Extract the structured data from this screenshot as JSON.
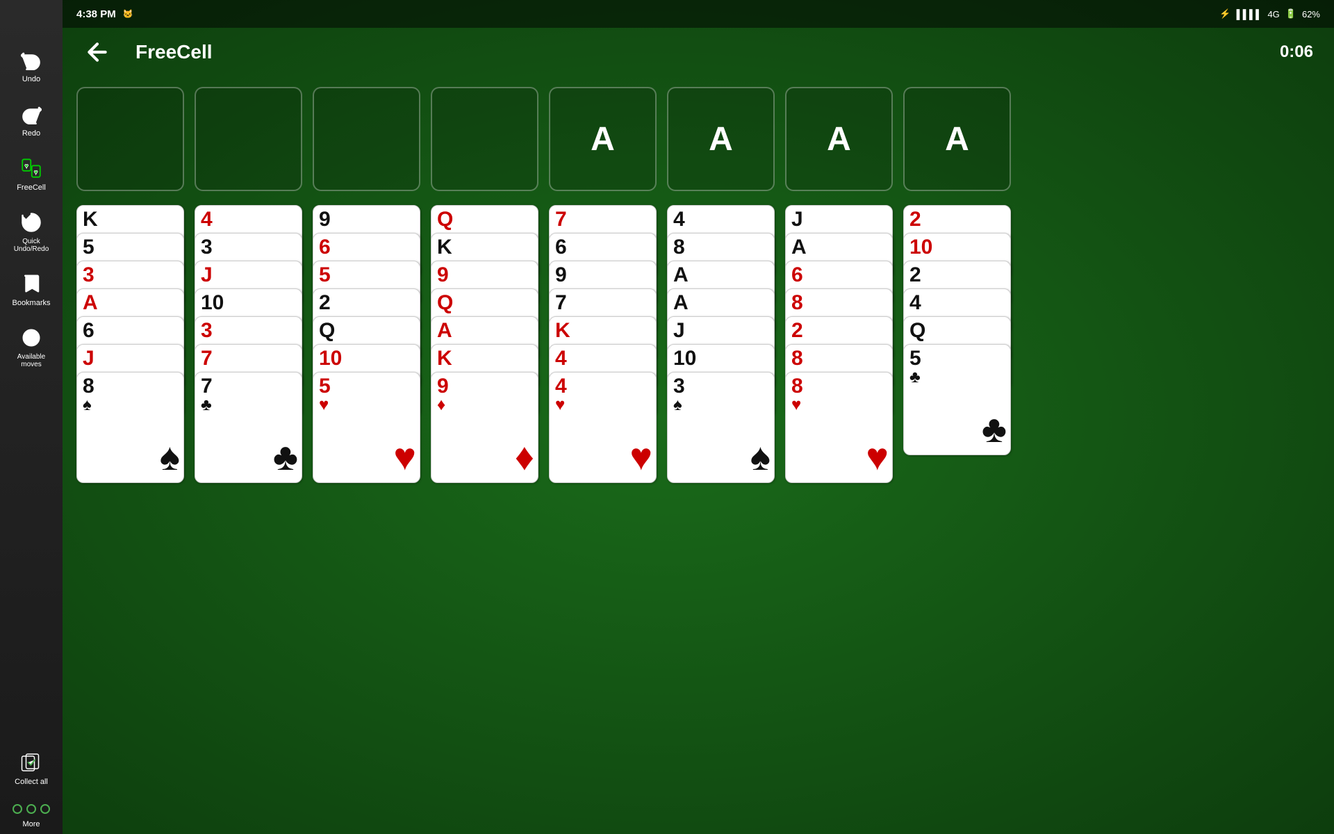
{
  "statusbar": {
    "time": "4:38 PM",
    "signal": "4G",
    "battery": "62%"
  },
  "header": {
    "title": "FreeCell",
    "timer": "0:06",
    "undo_label": "Undo",
    "redo_label": "Redo",
    "quick_undo_label": "Quick Undo/Redo",
    "bookmarks_label": "Bookmarks",
    "available_moves_label": "Available moves",
    "collect_all_label": "Collect all",
    "more_label": "More"
  },
  "free_cells": [
    {
      "id": 1,
      "card": null
    },
    {
      "id": 2,
      "card": null
    },
    {
      "id": 3,
      "card": null
    },
    {
      "id": 4,
      "card": null
    }
  ],
  "foundation_cells": [
    {
      "id": 1,
      "label": "A"
    },
    {
      "id": 2,
      "label": "A"
    },
    {
      "id": 3,
      "label": "A"
    },
    {
      "id": 4,
      "label": "A"
    }
  ],
  "columns": [
    {
      "id": 1,
      "cards": [
        {
          "value": "K",
          "suit": "♠",
          "color": "black"
        },
        {
          "value": "5",
          "suit": "♠",
          "color": "black"
        },
        {
          "value": "3",
          "suit": "♥",
          "color": "red"
        },
        {
          "value": "A",
          "suit": "♦",
          "color": "red"
        },
        {
          "value": "6",
          "suit": "♠",
          "color": "black"
        },
        {
          "value": "J",
          "suit": "♥",
          "color": "red"
        },
        {
          "value": "8",
          "suit": "♠",
          "color": "black"
        }
      ]
    },
    {
      "id": 2,
      "cards": [
        {
          "value": "4",
          "suit": "♦",
          "color": "red"
        },
        {
          "value": "3",
          "suit": "♣",
          "color": "black"
        },
        {
          "value": "J",
          "suit": "♦",
          "color": "red"
        },
        {
          "value": "10",
          "suit": "♣",
          "color": "black"
        },
        {
          "value": "3",
          "suit": "♦",
          "color": "red"
        },
        {
          "value": "7",
          "suit": "♦",
          "color": "red"
        },
        {
          "value": "7",
          "suit": "♣",
          "color": "black"
        }
      ]
    },
    {
      "id": 3,
      "cards": [
        {
          "value": "9",
          "suit": "♣",
          "color": "black"
        },
        {
          "value": "6",
          "suit": "♥",
          "color": "red"
        },
        {
          "value": "5",
          "suit": "♦",
          "color": "red"
        },
        {
          "value": "2",
          "suit": "♣",
          "color": "black"
        },
        {
          "value": "Q",
          "suit": "♣",
          "color": "black"
        },
        {
          "value": "10",
          "suit": "♥",
          "color": "red"
        },
        {
          "value": "5",
          "suit": "♥",
          "color": "red"
        }
      ]
    },
    {
      "id": 4,
      "cards": [
        {
          "value": "Q",
          "suit": "♦",
          "color": "red"
        },
        {
          "value": "K",
          "suit": "♣",
          "color": "black"
        },
        {
          "value": "9",
          "suit": "♦",
          "color": "red"
        },
        {
          "value": "Q",
          "suit": "♥",
          "color": "red"
        },
        {
          "value": "A",
          "suit": "♥",
          "color": "red"
        },
        {
          "value": "K",
          "suit": "♥",
          "color": "red"
        },
        {
          "value": "9",
          "suit": "♦",
          "color": "red"
        }
      ]
    },
    {
      "id": 5,
      "cards": [
        {
          "value": "7",
          "suit": "♥",
          "color": "red"
        },
        {
          "value": "6",
          "suit": "♣",
          "color": "black"
        },
        {
          "value": "9",
          "suit": "♠",
          "color": "black"
        },
        {
          "value": "7",
          "suit": "♠",
          "color": "black"
        },
        {
          "value": "K",
          "suit": "♦",
          "color": "red"
        },
        {
          "value": "4",
          "suit": "♥",
          "color": "red"
        },
        {
          "value": "4",
          "suit": "♥",
          "color": "red"
        }
      ]
    },
    {
      "id": 6,
      "cards": [
        {
          "value": "4",
          "suit": "♣",
          "color": "black"
        },
        {
          "value": "8",
          "suit": "♣",
          "color": "black"
        },
        {
          "value": "A",
          "suit": "♣",
          "color": "black"
        },
        {
          "value": "A",
          "suit": "♠",
          "color": "black"
        },
        {
          "value": "J",
          "suit": "♠",
          "color": "black"
        },
        {
          "value": "10",
          "suit": "♠",
          "color": "black"
        },
        {
          "value": "3",
          "suit": "♠",
          "color": "black"
        }
      ]
    },
    {
      "id": 7,
      "cards": [
        {
          "value": "J",
          "suit": "♣",
          "color": "black"
        },
        {
          "value": "A",
          "suit": "♣",
          "color": "black"
        },
        {
          "value": "6",
          "suit": "♦",
          "color": "red"
        },
        {
          "value": "8",
          "suit": "♦",
          "color": "red"
        },
        {
          "value": "2",
          "suit": "♥",
          "color": "red"
        },
        {
          "value": "8",
          "suit": "♥",
          "color": "red"
        },
        {
          "value": "8",
          "suit": "♥",
          "color": "red"
        }
      ]
    },
    {
      "id": 8,
      "cards": [
        {
          "value": "2",
          "suit": "♦",
          "color": "red"
        },
        {
          "value": "10",
          "suit": "♦",
          "color": "red"
        },
        {
          "value": "2",
          "suit": "♠",
          "color": "black"
        },
        {
          "value": "4",
          "suit": "♠",
          "color": "black"
        },
        {
          "value": "Q",
          "suit": "♠",
          "color": "black"
        },
        {
          "value": "5",
          "suit": "♣",
          "color": "black"
        }
      ]
    }
  ]
}
